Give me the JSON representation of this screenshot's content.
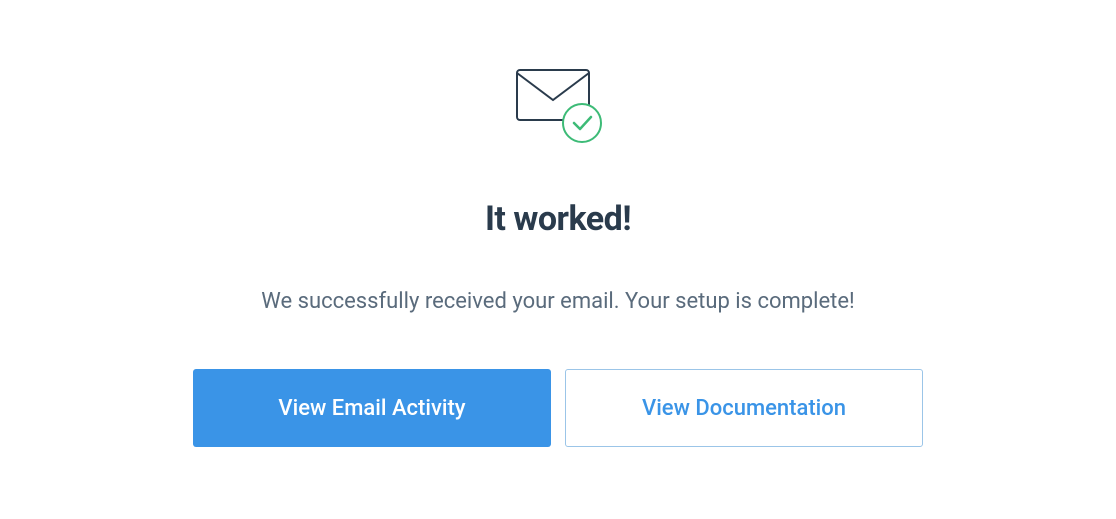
{
  "heading": "It worked!",
  "description": "We successfully received your email. Your setup is complete!",
  "buttons": {
    "primary_label": "View Email Activity",
    "secondary_label": "View Documentation"
  }
}
